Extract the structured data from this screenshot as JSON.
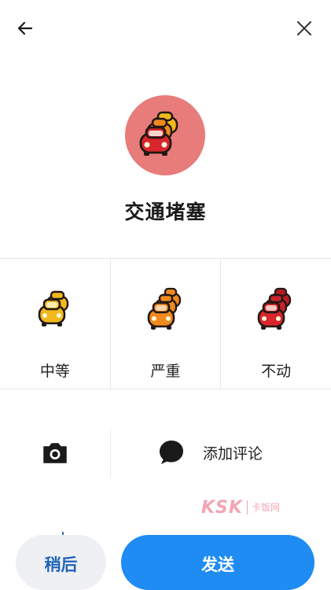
{
  "header": {
    "back_icon": "arrow-left-icon",
    "close_icon": "close-icon"
  },
  "report": {
    "icon": "traffic-jam-cars-icon",
    "accent_color": "#e77c7a",
    "title": "交通堵塞"
  },
  "severity_options": [
    {
      "label": "中等",
      "icon": "moderate-traffic-icon",
      "color": "#f2b81c"
    },
    {
      "label": "严重",
      "icon": "heavy-traffic-icon",
      "color": "#f08a1e"
    },
    {
      "label": "不动",
      "icon": "standstill-traffic-icon",
      "color": "#d9262c"
    }
  ],
  "actions": {
    "camera_icon": "camera-icon",
    "comment_icon": "speech-bubble-icon",
    "comment_label": "添加评论"
  },
  "watermark": {
    "logo": "KSK",
    "text": "卡饭网"
  },
  "footer": {
    "later_label": "稍后",
    "send_label": "发送",
    "send_color": "#1e8cf2"
  }
}
